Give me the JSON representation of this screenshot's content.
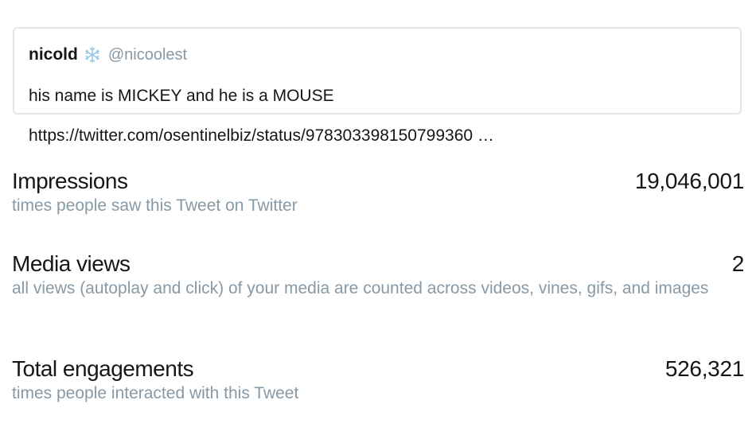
{
  "tweet": {
    "display_name": "nicold",
    "handle": "@nicoolest",
    "emoji_icon": "snowflake-icon",
    "text_line1": "his name is MICKEY and he is a MOUSE",
    "text_line2": "https://twitter.com/osentinelbiz/status/978303398150799360 …"
  },
  "metrics": {
    "impressions": {
      "label": "Impressions",
      "value": "19,046,001",
      "description": "times people saw this Tweet on Twitter"
    },
    "media_views": {
      "label": "Media views",
      "value": "2",
      "description": "all views (autoplay and click) of your media are counted across videos, vines, gifs, and images"
    },
    "total_engagements": {
      "label": "Total engagements",
      "value": "526,321",
      "description": "times people interacted with this Tweet"
    }
  },
  "colors": {
    "primary_text": "#14171a",
    "secondary_text": "#8899a6",
    "border": "#e1e8ed",
    "snowflake": "#9ccbe8"
  }
}
